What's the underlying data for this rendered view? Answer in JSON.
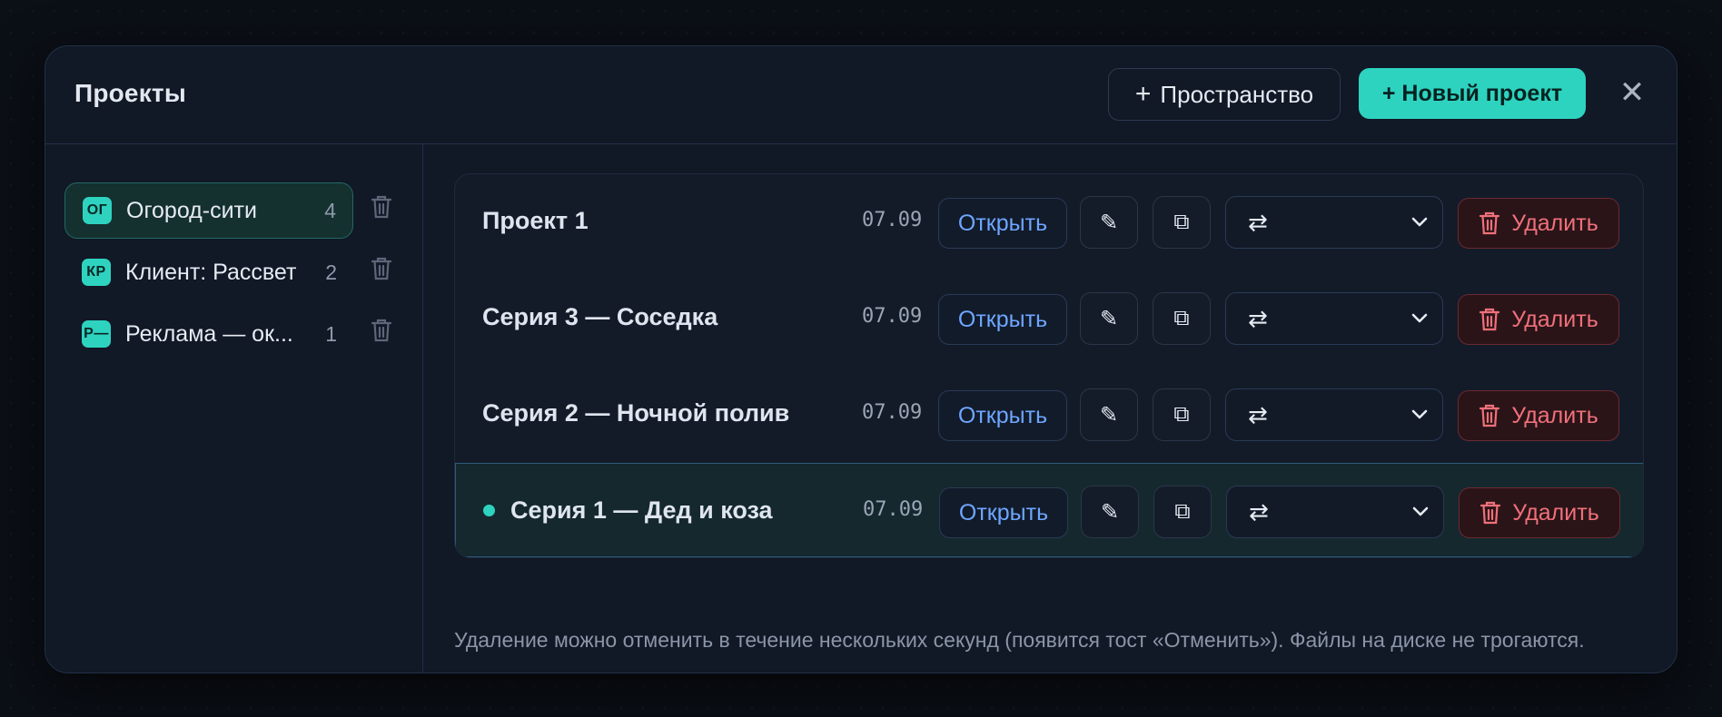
{
  "header": {
    "title": "Проекты",
    "add_space_label": "Пространство",
    "add_space_plus": "+",
    "new_project_label": "+ Новый проект",
    "close_glyph": "✕"
  },
  "workspaces": [
    {
      "badge": "ОГ",
      "label": "Огород-сити",
      "count": "4",
      "active": true
    },
    {
      "badge": "КР",
      "label": "Клиент: Рассвет",
      "count": "2",
      "active": false
    },
    {
      "badge": "Р—",
      "label": "Реклама — ок...",
      "count": "1",
      "active": false
    }
  ],
  "projects": [
    {
      "name": "Проект 1",
      "date": "07.09",
      "active": false
    },
    {
      "name": "Серия 3 — Соседка",
      "date": "07.09",
      "active": false
    },
    {
      "name": "Серия 2 — Ночной полив",
      "date": "07.09",
      "active": false
    },
    {
      "name": "Серия 1 — Дед и коза",
      "date": "07.09",
      "active": true
    }
  ],
  "row_actions": {
    "open_label": "Открыть",
    "edit_glyph": "✎",
    "duplicate_glyph": "⧉",
    "move_glyph": "⇄",
    "delete_label": "Удалить"
  },
  "hint": "Удаление можно отменить в течение нескольких секунд (появится тост «Отменить»). Файлы на диске не трогаются.",
  "colors": {
    "accent": "#2ed3c0",
    "link": "#6ea6ff",
    "danger": "#f0707a",
    "background": "#111826"
  },
  "icons": {
    "trash": "trash-icon",
    "chevron": "chevron-down-icon",
    "close": "close-icon"
  }
}
